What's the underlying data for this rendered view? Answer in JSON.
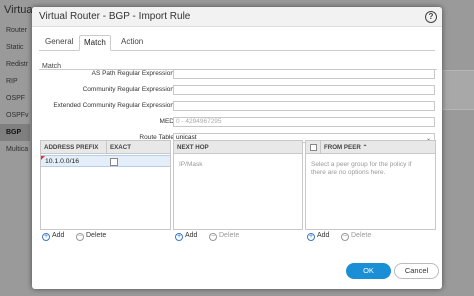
{
  "background": {
    "title": "Virtua",
    "nav_items": [
      "Router",
      "Static",
      "Redistr",
      "RIP",
      "OSPF",
      "OSPFv",
      "BGP",
      "Multica"
    ]
  },
  "dialog": {
    "title": "Virtual Router - BGP - Import Rule",
    "help_icon": "?",
    "tabs": [
      "General",
      "Match",
      "Action"
    ],
    "active_tab": "Match",
    "section_label": "Match",
    "fields": {
      "as_path": {
        "label": "AS Path Regular Expression",
        "value": ""
      },
      "community": {
        "label": "Community Regular Expression",
        "value": ""
      },
      "ext_community": {
        "label": "Extended Community Regular Expression",
        "value": ""
      },
      "med": {
        "label": "MED",
        "placeholder": "0 - 4294967295"
      },
      "route_table": {
        "label": "Route Table",
        "value": "unicast"
      }
    },
    "address_grid": {
      "col_prefix": "ADDRESS PREFIX",
      "col_exact": "EXACT",
      "row_prefix": "10.1.0.0/16",
      "add_label": "Add",
      "delete_label": "Delete"
    },
    "nexthop_grid": {
      "col_header": "NEXT HOP",
      "placeholder": "IP/Mask",
      "add_label": "Add",
      "delete_label": "Delete"
    },
    "peer_grid": {
      "col_header": "FROM PEER",
      "placeholder_line1": "Select a peer group for the policy if",
      "placeholder_line2": "there are no options here.",
      "add_label": "Add",
      "delete_label": "Delete"
    },
    "ok_label": "OK",
    "cancel_label": "Cancel"
  },
  "colors": {
    "primary": "#1a8fd6",
    "selected_row": "#e4eef9",
    "error_marker": "#dd3333"
  }
}
